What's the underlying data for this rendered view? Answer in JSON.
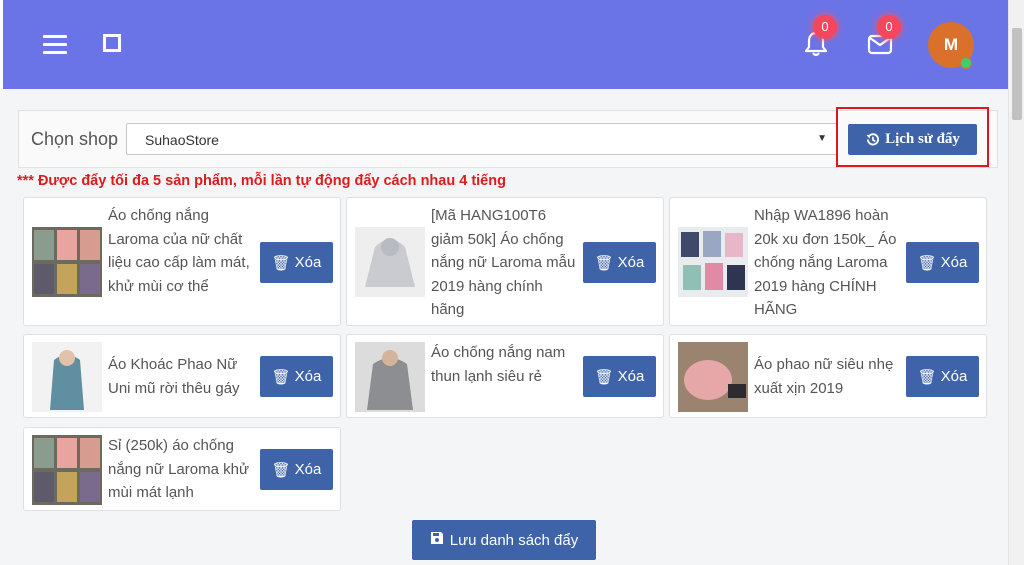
{
  "header": {
    "notifications_count": "0",
    "messages_count": "0",
    "avatar_initial": "M",
    "accent_color": "#6b74e6"
  },
  "shop": {
    "label": "Chọn shop",
    "selected": "SuhaoStore",
    "history_button": "Lịch sử đẩy"
  },
  "notice": "*** Được đẩy tối đa 5 sản phẩm, mỗi lần tự động đẩy cách nhau 4 tiếng",
  "products": [
    {
      "title": "Áo chống nắng Laroma của nữ chất liệu cao cấp làm mát, khử mùi cơ thể",
      "delete_label": "Xóa"
    },
    {
      "title": "[Mã HANG100T6 giảm 50k] Áo chống nắng nữ Laroma mẫu 2019 hàng chính hãng",
      "delete_label": "Xóa"
    },
    {
      "title": "Nhập WA1896 hoàn 20k xu đơn 150k_ Áo chống nắng Laroma 2019 hàng CHÍNH HÃNG",
      "delete_label": "Xóa"
    },
    {
      "title": "Áo Khoác Phao Nữ Uni mũ rời thêu gáy",
      "delete_label": "Xóa"
    },
    {
      "title": "Áo chống nắng nam thun lạnh siêu rẻ",
      "delete_label": "Xóa"
    },
    {
      "title": "Áo phao nữ siêu nhẹ xuất xịn 2019",
      "delete_label": "Xóa"
    },
    {
      "title": "Sỉ (250k) áo chống nắng nữ Laroma khử mùi mát lạnh",
      "delete_label": "Xóa"
    }
  ],
  "save_button": "Lưu danh sách đẩy",
  "colors": {
    "primary_button": "#3e63a8",
    "notice": "#e01b1b",
    "badge": "#f4465d"
  }
}
